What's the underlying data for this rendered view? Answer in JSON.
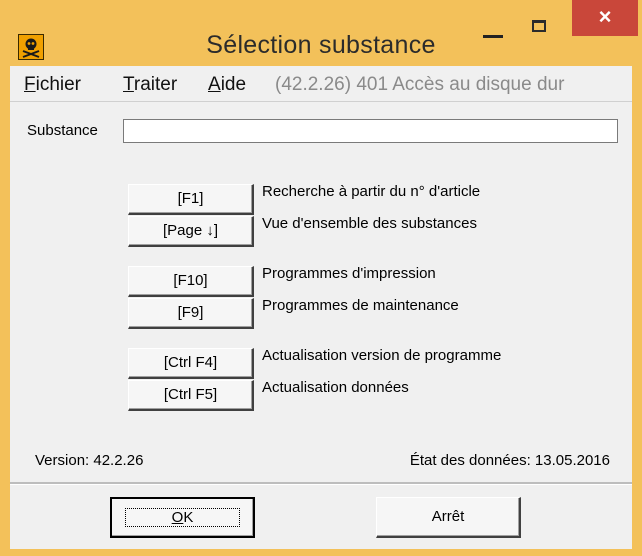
{
  "window": {
    "title": "Sélection substance",
    "close_glyph": "×",
    "icon": "skull-crossbones-icon"
  },
  "menu": {
    "fichier": {
      "first": "F",
      "rest": "ichier"
    },
    "traiter": {
      "first": "T",
      "rest": "raiter"
    },
    "aide": {
      "first": "A",
      "rest": "ide"
    },
    "status": "(42.2.26) 401 Accès au disque dur"
  },
  "substance": {
    "label": "Substance",
    "value": ""
  },
  "actions": [
    {
      "key": "[F1]",
      "desc": "Recherche à partir du n° d'article"
    },
    {
      "key": "[Page ↓]",
      "desc": "Vue d'ensemble des substances"
    },
    {
      "key": "[F10]",
      "desc": "Programmes d'impression"
    },
    {
      "key": "[F9]",
      "desc": "Programmes de maintenance"
    },
    {
      "key": "[Ctrl F4]",
      "desc": "Actualisation version de programme"
    },
    {
      "key": "[Ctrl F5]",
      "desc": "Actualisation données"
    }
  ],
  "footer": {
    "version": "Version:  42.2.26",
    "etat": "État des données:  13.05.2016"
  },
  "buttons": {
    "ok": {
      "first": "O",
      "rest": "K"
    },
    "stop": "Arrêt"
  },
  "colors": {
    "frame": "#f3c15a",
    "close": "#c9473a",
    "client": "#f0f0f0"
  }
}
